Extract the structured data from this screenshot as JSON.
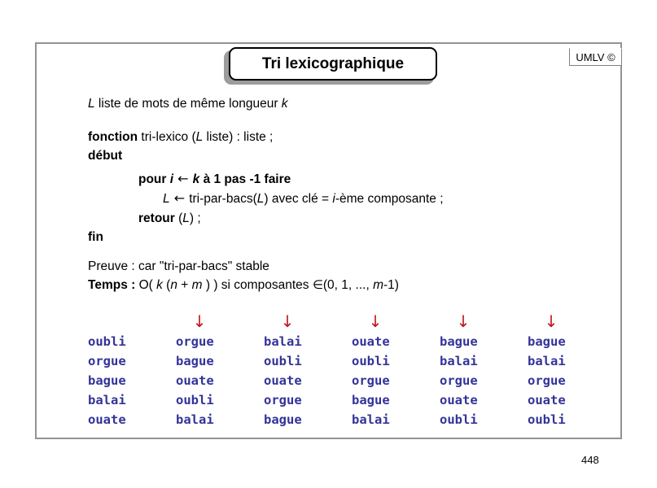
{
  "slide": {
    "title": "Tri lexicographique",
    "branding": "UMLV ©",
    "page_number": "448"
  },
  "definition": {
    "var": "L",
    "text": " liste de mots de même longueur ",
    "len_var": "k"
  },
  "algorithm": {
    "fonction_kw": "fonction",
    "fonction_rest": " tri-lexico (",
    "fonction_param": "L",
    "fonction_tail": " liste) : liste ;",
    "debut": "début",
    "pour_kw": "pour ",
    "pour_i": "i",
    "pour_arrow": " ← ",
    "pour_k": "k",
    "pour_tail": " à 1 pas -1 faire",
    "affect_L": "L",
    "affect_arrow": " ← ",
    "affect_mid": " tri-par-bacs(",
    "affect_L2": "L",
    "affect_mid2": ") avec clé = ",
    "affect_i": "i",
    "affect_tail": "-ème composante ;",
    "retour_kw": "retour",
    "retour_open": " (",
    "retour_L": "L",
    "retour_tail": ") ;",
    "fin": "fin"
  },
  "notes": {
    "preuve": "Preuve : car \"tri-par-bacs\" stable",
    "temps_label": "Temps :",
    "temps_o": " O( ",
    "temps_k": "k",
    "temps_open": " (",
    "temps_n": "n",
    "temps_plus": " + ",
    "temps_m": "m",
    "temps_close": " ) ) si composantes ",
    "temps_elem": "∈",
    "temps_set_open": "(0, 1, ..., ",
    "temps_m2": "m",
    "temps_set_close": "-1)"
  },
  "chart_data": {
    "type": "table",
    "title": "Tri lexicographique — passes successives",
    "arrow_symbol": "↓",
    "arrow_color": "#c0171f",
    "word_color": "#333399",
    "columns": [
      {
        "index": 1,
        "has_arrow": false,
        "words": [
          "oubli",
          "orgue",
          "bague",
          "balai",
          "ouate"
        ]
      },
      {
        "index": 2,
        "has_arrow": true,
        "words": [
          "orgue",
          "bague",
          "ouate",
          "oubli",
          "balai"
        ]
      },
      {
        "index": 3,
        "has_arrow": true,
        "words": [
          "balai",
          "oubli",
          "ouate",
          "orgue",
          "bague"
        ]
      },
      {
        "index": 4,
        "has_arrow": true,
        "words": [
          "ouate",
          "oubli",
          "orgue",
          "bague",
          "balai"
        ]
      },
      {
        "index": 5,
        "has_arrow": true,
        "words": [
          "bague",
          "balai",
          "orgue",
          "ouate",
          "oubli"
        ]
      },
      {
        "index": 6,
        "has_arrow": true,
        "words": [
          "bague",
          "balai",
          "orgue",
          "ouate",
          "oubli"
        ]
      }
    ]
  }
}
